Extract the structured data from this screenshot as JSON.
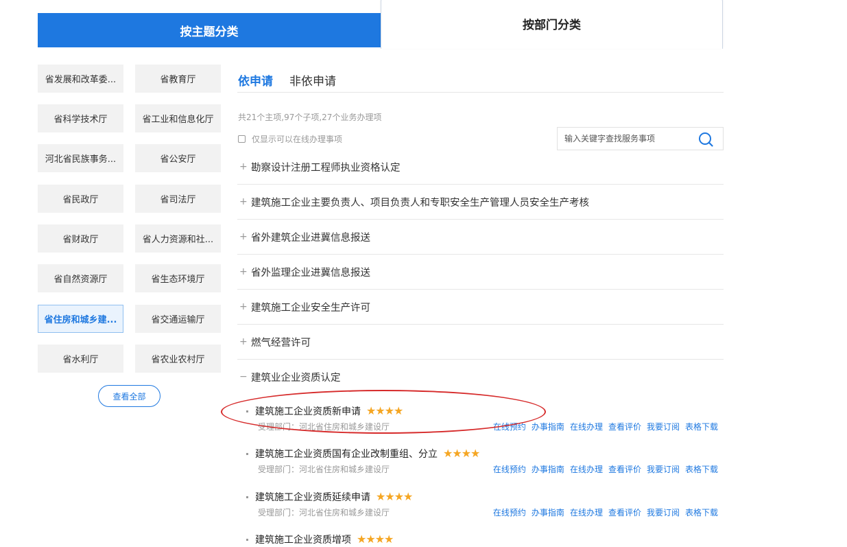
{
  "tabs": {
    "topic": "按主题分类",
    "department": "按部门分类"
  },
  "departments": [
    "省发展和改革委...",
    "省教育厅",
    "省科学技术厅",
    "省工业和信息化厅",
    "河北省民族事务...",
    "省公安厅",
    "省民政厅",
    "省司法厅",
    "省财政厅",
    "省人力资源和社...",
    "省自然资源厅",
    "省生态环境厅",
    "省住房和城乡建...",
    "省交通运输厅",
    "省水利厅",
    "省农业农村厅"
  ],
  "active_department": "省住房和城乡建...",
  "view_all": "查看全部",
  "subtabs": {
    "active": "依申请",
    "other": "非依申请"
  },
  "summary": "共21个主项,97个子项,27个业务办理项",
  "online_filter": "仅显示可以在线办理事项",
  "search": {
    "placeholder": "输入关键字查找服务事项"
  },
  "items": [
    {
      "sign": "+",
      "label": "勘察设计注册工程师执业资格认定"
    },
    {
      "sign": "+",
      "label": "建筑施工企业主要负责人、项目负责人和专职安全生产管理人员安全生产考核"
    },
    {
      "sign": "+",
      "label": "省外建筑企业进冀信息报送"
    },
    {
      "sign": "+",
      "label": "省外监理企业进冀信息报送"
    },
    {
      "sign": "+",
      "label": "建筑施工企业安全生产许可"
    },
    {
      "sign": "+",
      "label": "燃气经营许可"
    },
    {
      "sign": "−",
      "label": "建筑业企业资质认定"
    }
  ],
  "subitems": [
    {
      "title": "建筑施工企业资质新申请",
      "stars": "★★★★",
      "dept": "受理部门：河北省住房和城乡建设厅"
    },
    {
      "title": "建筑施工企业资质国有企业改制重组、分立",
      "stars": "★★★★",
      "dept": "受理部门：河北省住房和城乡建设厅"
    },
    {
      "title": "建筑施工企业资质延续申请",
      "stars": "★★★★",
      "dept": "受理部门：河北省住房和城乡建设厅"
    },
    {
      "title": "建筑施工企业资质增项",
      "stars": "★★★★",
      "dept": ""
    }
  ],
  "actions": [
    "在线预约",
    "办事指南",
    "在线办理",
    "查看评价",
    "我要订阅",
    "表格下载"
  ],
  "colors": {
    "accent": "#1e78e0",
    "star": "#f5a623",
    "highlight": "#d62a2a"
  }
}
